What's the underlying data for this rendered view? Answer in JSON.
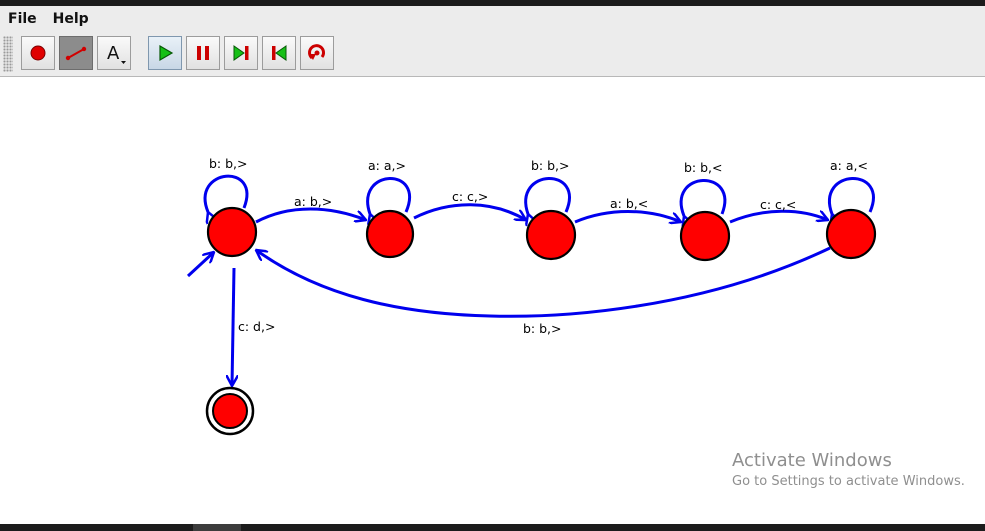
{
  "menu": {
    "items": [
      "File",
      "Help"
    ]
  },
  "toolbar": {
    "buttons": [
      {
        "name": "add-state-tool",
        "icon": "red-circle-icon"
      },
      {
        "name": "add-transition-tool",
        "icon": "transition-arrow-icon",
        "active": true
      },
      {
        "name": "add-note-tool",
        "icon": "text-a-icon"
      },
      {
        "name": "run-button",
        "icon": "play-icon"
      },
      {
        "name": "pause-button",
        "icon": "pause-icon"
      },
      {
        "name": "step-forward-button",
        "icon": "step-forward-icon"
      },
      {
        "name": "step-back-button",
        "icon": "step-back-icon"
      },
      {
        "name": "reset-button",
        "icon": "reset-icon"
      }
    ],
    "note_glyph": "A"
  },
  "diagram": {
    "colors": {
      "state_fill": "#ff0000",
      "edge": "#0000ee",
      "label": "#000000"
    },
    "labels": {
      "loop_s0": "b: b,>",
      "loop_s1": "a: a,>",
      "loop_s2": "b: b,>",
      "loop_s3": "b: b,<",
      "loop_s4": "a: a,<",
      "e01": "a: b,>",
      "e12": "c: c,>",
      "e23": "a: b,<",
      "e34": "c: c,<",
      "e40": "b: b,>",
      "e0f": "c: d,>"
    }
  },
  "watermark": {
    "line1": "Activate Windows",
    "line2": "Go to Settings to activate Windows."
  }
}
